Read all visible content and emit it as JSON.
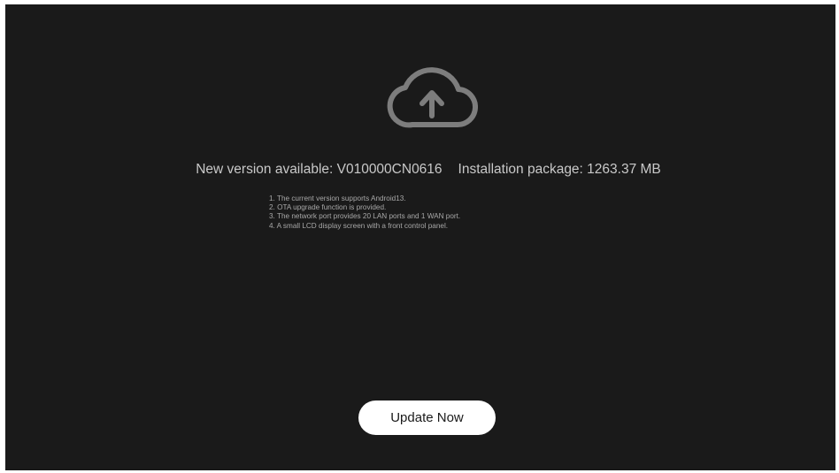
{
  "icon": "cloud-upload-icon",
  "update_info": {
    "new_version": "New version available: V010000CN0616",
    "package_size": "Installation package: 1263.37 MB"
  },
  "release_notes": [
    "1. The current version supports Android13.",
    "2. OTA upgrade function is provided.",
    "3. The network port provides 20 LAN ports and 1 WAN port.",
    "4. A small LCD display screen with a front control panel."
  ],
  "actions": {
    "update_label": "Update Now"
  },
  "colors": {
    "background": "#1a1a1a",
    "text": "#c9c9c9",
    "button_bg": "#ffffff",
    "button_text": "#1a1a1a"
  }
}
